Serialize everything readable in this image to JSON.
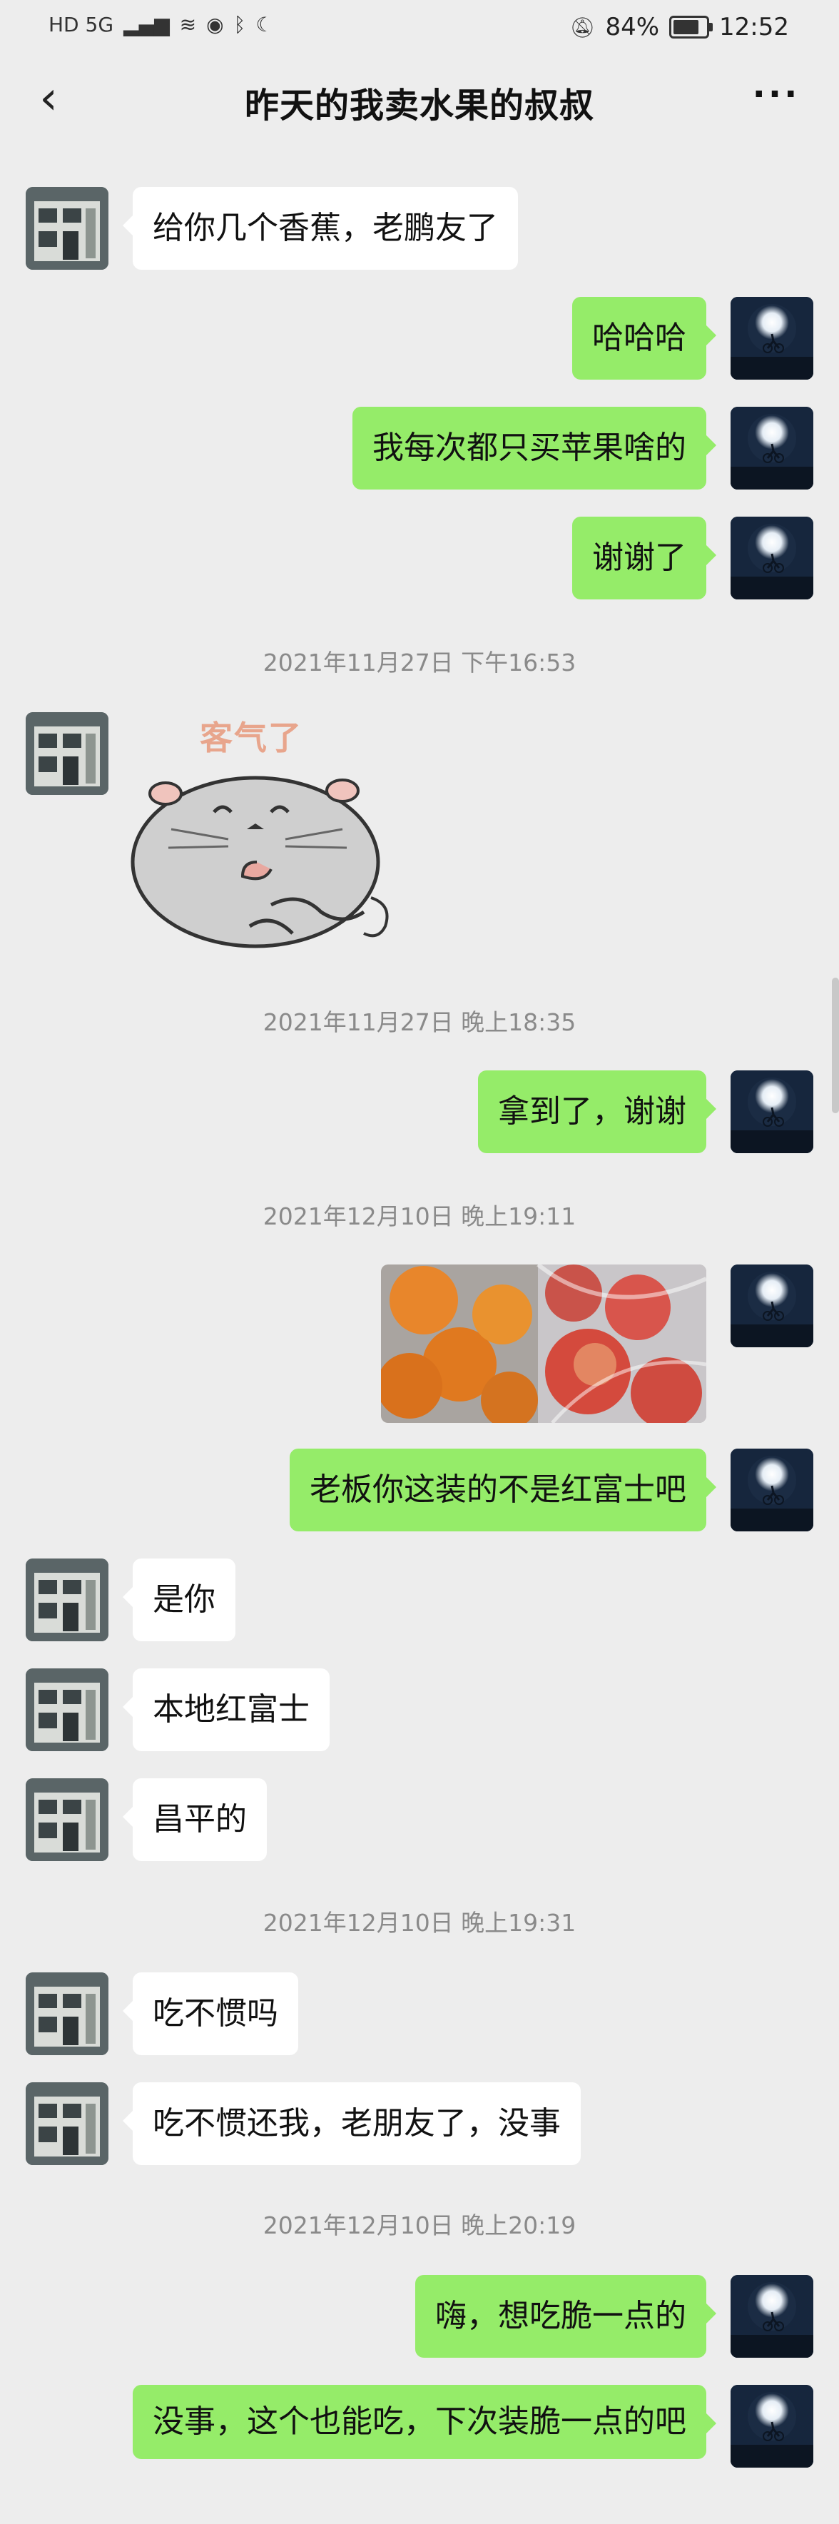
{
  "status_bar": {
    "network_badges": "HD 5G",
    "battery": "84%",
    "time": "12:52"
  },
  "header": {
    "back_icon": "chevron-left-icon",
    "title": "昨天的我卖水果的叔叔",
    "more_icon": "ellipsis-icon"
  },
  "sticker_text": "客气了",
  "messages": [
    {
      "type": "text",
      "side": "in",
      "text": "给你几个香蕉，老鹏友了"
    },
    {
      "type": "text",
      "side": "out",
      "text": "哈哈哈"
    },
    {
      "type": "text",
      "side": "out",
      "text": "我每次都只买苹果啥的"
    },
    {
      "type": "text",
      "side": "out",
      "text": "谢谢了"
    },
    {
      "type": "time",
      "text": "2021年11月27日 下午16:53"
    },
    {
      "type": "sticker",
      "side": "in"
    },
    {
      "type": "time",
      "text": "2021年11月27日 晚上18:35"
    },
    {
      "type": "text",
      "side": "out",
      "text": "拿到了，谢谢"
    },
    {
      "type": "time",
      "text": "2021年12月10日 晚上19:11"
    },
    {
      "type": "image",
      "side": "out"
    },
    {
      "type": "text",
      "side": "out",
      "text": "老板你这装的不是红富士吧"
    },
    {
      "type": "text",
      "side": "in",
      "text": "是你"
    },
    {
      "type": "text",
      "side": "in",
      "text": "本地红富士"
    },
    {
      "type": "text",
      "side": "in",
      "text": "昌平的"
    },
    {
      "type": "time",
      "text": "2021年12月10日 晚上19:31"
    },
    {
      "type": "text",
      "side": "in",
      "text": "吃不惯吗"
    },
    {
      "type": "text",
      "side": "in",
      "text": "吃不惯还我，老朋友了，没事"
    },
    {
      "type": "time",
      "text": "2021年12月10日 晚上20:19"
    },
    {
      "type": "text",
      "side": "out",
      "text": "嗨，想吃脆一点的"
    },
    {
      "type": "text",
      "side": "out",
      "text": "没事，这个也能吃，下次装脆一点的吧"
    }
  ],
  "colors": {
    "background": "#ededed",
    "outgoing_bubble": "#95ec69",
    "incoming_bubble": "#ffffff",
    "timestamp": "#8a8a8a"
  }
}
